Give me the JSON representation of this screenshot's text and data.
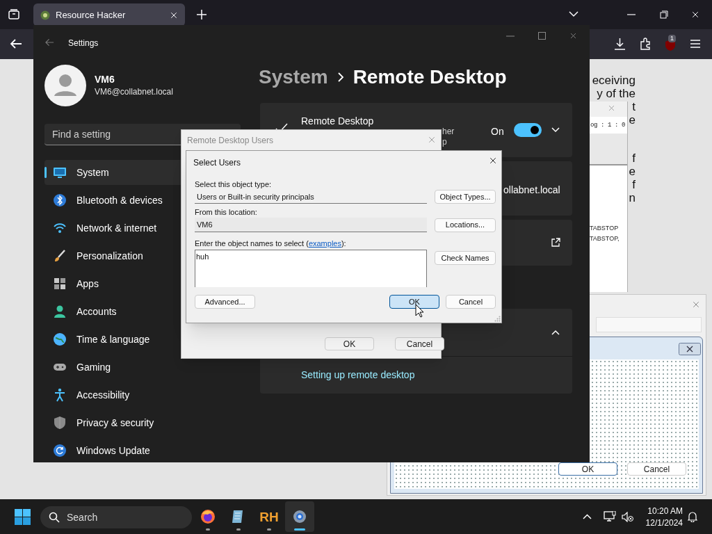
{
  "browser": {
    "tab_title": "Resource Hacker",
    "extension_badge": "1"
  },
  "page_fragments": [
    "eceiving",
    "y of the",
    "t",
    "e",
    "f",
    "e",
    "f",
    "n"
  ],
  "resource_hacker": {
    "dialog_label": "og : 1 : 0",
    "code_lines": [
      "TABSTOP",
      "TABSTOP,"
    ]
  },
  "dialog_preview": {
    "buttons": [
      {
        "label": "OK",
        "default": true
      },
      {
        "label": "Cancel",
        "default": false
      }
    ]
  },
  "settings": {
    "title": "Settings",
    "user": {
      "name": "VM6",
      "email": "VM6@collabnet.local"
    },
    "search": {
      "placeholder": "Find a setting"
    },
    "nav": [
      {
        "label": "System",
        "kind": "display",
        "selected": true
      },
      {
        "label": "Bluetooth & devices",
        "kind": "bluetooth",
        "selected": false
      },
      {
        "label": "Network & internet",
        "kind": "wifi",
        "selected": false
      },
      {
        "label": "Personalization",
        "kind": "brush",
        "selected": false
      },
      {
        "label": "Apps",
        "kind": "apps",
        "selected": false
      },
      {
        "label": "Accounts",
        "kind": "person",
        "selected": false
      },
      {
        "label": "Time & language",
        "kind": "globe",
        "selected": false
      },
      {
        "label": "Gaming",
        "kind": "gamepad",
        "selected": false
      },
      {
        "label": "Accessibility",
        "kind": "accessibility",
        "selected": false
      },
      {
        "label": "Privacy & security",
        "kind": "shield",
        "selected": false
      },
      {
        "label": "Windows Update",
        "kind": "update",
        "selected": false
      }
    ],
    "breadcrumb": [
      "System",
      "Remote Desktop"
    ],
    "remote_desktop": {
      "title": "Remote Desktop",
      "subtitle_fragments": [
        "her",
        "p"
      ],
      "state_label": "On",
      "on": true,
      "expanded": false
    },
    "pc_name_fragment": "ollabnet.local",
    "expander": {
      "expanded": true,
      "link": "Setting up remote desktop"
    }
  },
  "rdu_dialog": {
    "title": "Remote Desktop Users",
    "buttons": [
      "OK",
      "Cancel"
    ]
  },
  "select_users": {
    "title": "Select Users",
    "object_type_label": "Select this object type:",
    "object_type": "Users or Built-in security principals",
    "object_types_button": "Object Types...",
    "location_label": "From this location:",
    "location": "VM6",
    "locations_button": "Locations...",
    "names_label_start": "Enter the object names to select (",
    "names_link": "examples",
    "names_label_end": "):",
    "names_value": "huh",
    "check_names_button": "Check Names",
    "advanced_button": "Advanced...",
    "buttons": [
      {
        "label": "OK",
        "default": true
      },
      {
        "label": "Cancel",
        "default": false
      }
    ]
  },
  "taskbar": {
    "search": "Search",
    "apps": [
      {
        "kind": "firefox",
        "active": false
      },
      {
        "kind": "notepad",
        "active": false
      },
      {
        "kind": "rh",
        "label": "RH",
        "active": false
      },
      {
        "kind": "settings",
        "active": true
      }
    ],
    "time": "10:20 AM",
    "date": "12/1/2024"
  }
}
